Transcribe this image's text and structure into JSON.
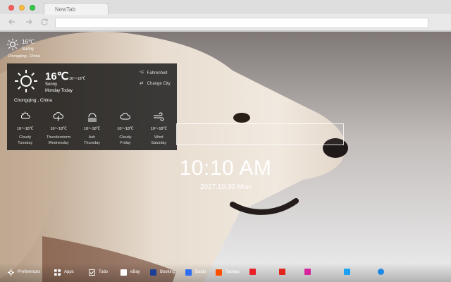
{
  "browser": {
    "tab_title": "NewTab",
    "nav_back_icon": "arrow-left-icon",
    "nav_forward_icon": "arrow-right-icon",
    "nav_reload_icon": "reload-icon"
  },
  "weather_mini": {
    "temp": "16℃",
    "condition": "Sunny",
    "city": "Chongqing , China",
    "icon": "sun-icon"
  },
  "weather_panel": {
    "temp": "16℃",
    "range": "10～18℃",
    "condition": "Sunny",
    "day": "Monday Today",
    "city": "Chongqing , China",
    "fahrenheit_icon": "°F",
    "fahrenheit_label": "Fahrenheit",
    "change_city_icon": "⇄",
    "change_city_label": "Change City",
    "forecast": [
      {
        "icon": "cloudy-sun-icon",
        "range": "10～18℃",
        "condition": "Cloudy",
        "day": "Tuesday"
      },
      {
        "icon": "thunderstorm-icon",
        "range": "10～18℃",
        "condition": "Thunderstorm",
        "day": "Wednesday"
      },
      {
        "icon": "ash-icon",
        "range": "10～18℃",
        "condition": "Ash",
        "day": "Thursday"
      },
      {
        "icon": "cloud-icon",
        "range": "10～18℃",
        "condition": "Cloudy",
        "day": "Friday"
      },
      {
        "icon": "wind-icon",
        "range": "10～18℃",
        "condition": "Wind",
        "day": "Saturday"
      }
    ]
  },
  "search": {
    "placeholder": ""
  },
  "clock": {
    "time": "10:10 AM",
    "date": "2017.10.30 Mon"
  },
  "bottom_bar": {
    "items": [
      {
        "label": "Preferences",
        "icon": "gear-icon",
        "color": "#ffffff"
      },
      {
        "label": "Apps",
        "icon": "grid-icon",
        "color": "#ffffff"
      },
      {
        "label": "Todo",
        "icon": "checkbox-icon",
        "color": "#ffffff"
      },
      {
        "label": "eBay",
        "icon": "ebay-icon",
        "color": "#ffffff"
      },
      {
        "label": "Booking",
        "icon": "booking-icon",
        "color": "#1c3f94"
      },
      {
        "label": "Baidu",
        "icon": "baidu-icon",
        "color": "#2f6ef1"
      },
      {
        "label": "Taobao",
        "icon": "taobao-icon",
        "color": "#ff5000"
      },
      {
        "label": "",
        "icon": "red-app-icon",
        "color": "#e8202a"
      },
      {
        "label": "",
        "icon": "jd-icon",
        "color": "#e1251b"
      },
      {
        "label": "",
        "icon": "instagram-icon",
        "color": "#d6249f"
      },
      {
        "label": "",
        "icon": "twitter-icon",
        "color": "#1da1f2"
      },
      {
        "label": "",
        "icon": "messenger-icon",
        "color": "#1e88e5"
      }
    ]
  }
}
